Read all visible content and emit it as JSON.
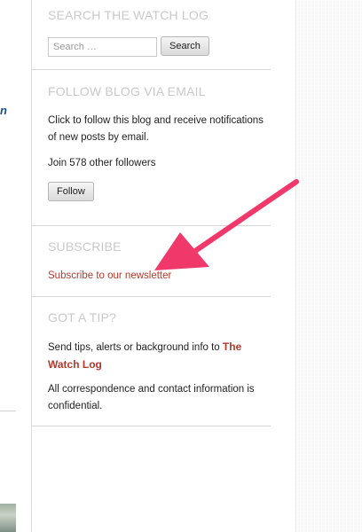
{
  "search": {
    "title": "SEARCH THE WATCH LOG",
    "placeholder": "Search …",
    "button_label": "Search"
  },
  "follow": {
    "title": "FOLLOW BLOG VIA EMAIL",
    "description": "Click to follow this blog and receive notifications of new posts by email.",
    "followers": "Join 578 other followers",
    "button_label": "Follow"
  },
  "subscribe": {
    "title": "SUBSCRIBE",
    "link_text": "Subscribe to our newsletter"
  },
  "tip": {
    "title": "GOT A TIP?",
    "text_before": "Send tips, alerts or background info to ",
    "link_text": "The Watch Log",
    "confidential": "All correspondence and contact information is confidential."
  },
  "annotation": {
    "arrow_color": "#f0386b"
  },
  "colors": {
    "widget_title": "#c9c9c9",
    "link": "#b03a2e"
  }
}
